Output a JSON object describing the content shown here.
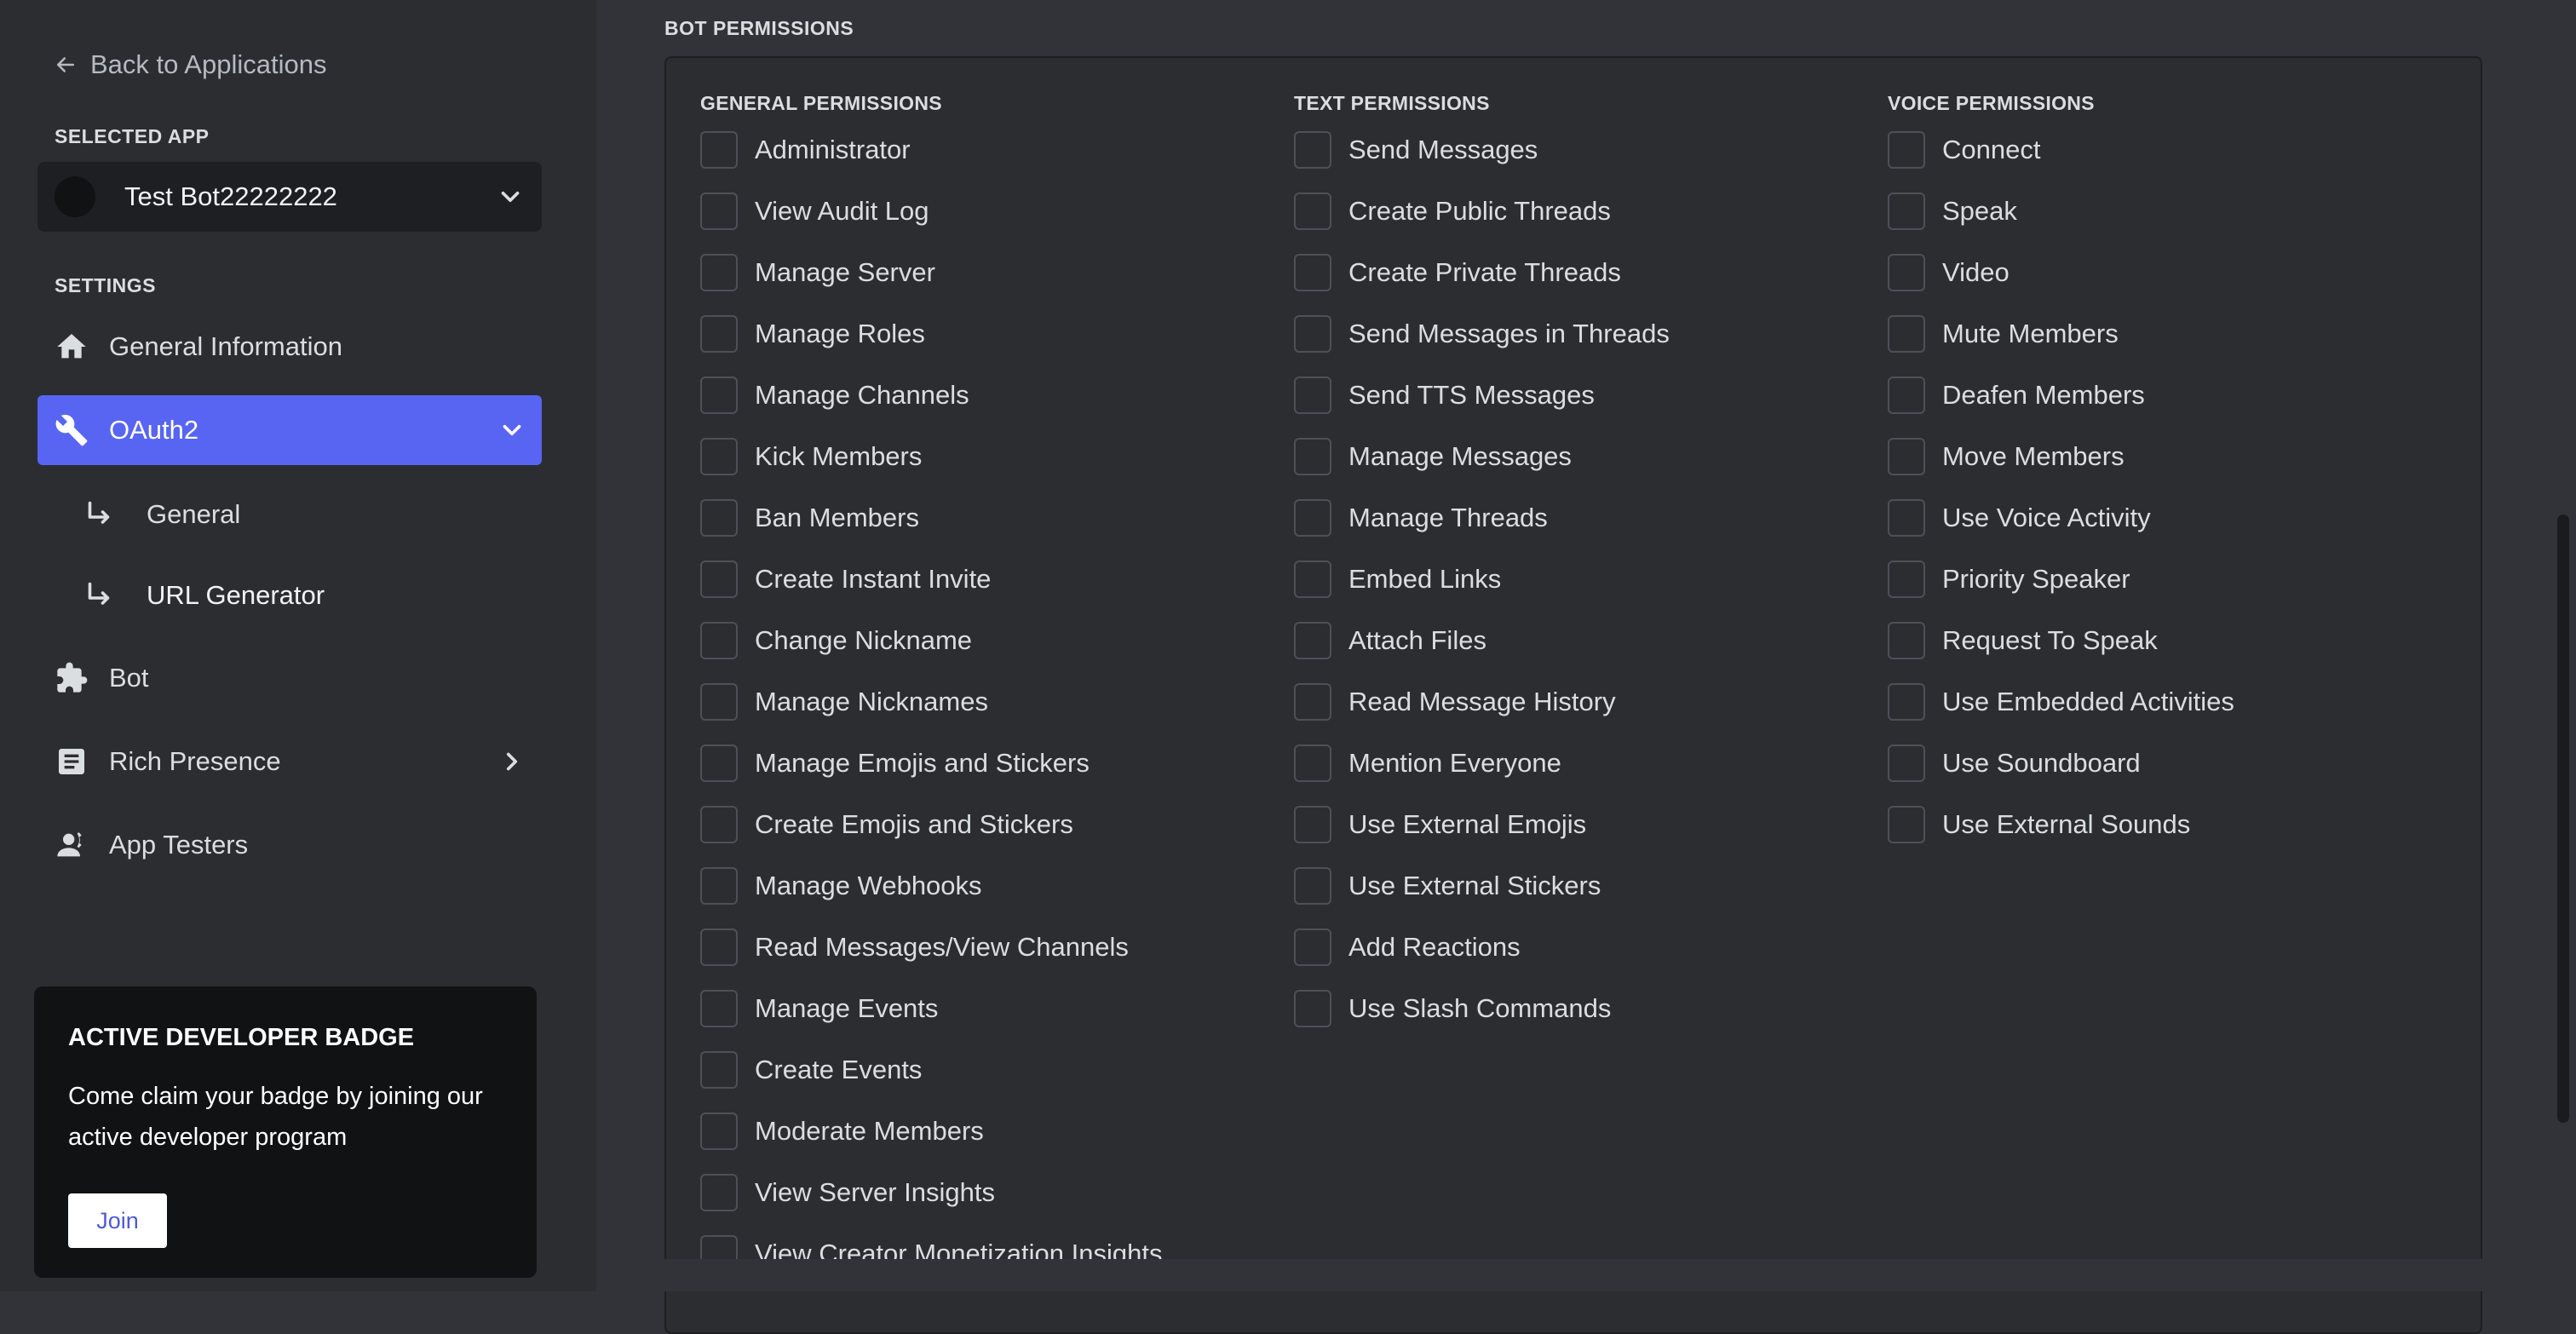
{
  "sidebar": {
    "back_label": "Back to Applications",
    "selected_app_label": "SELECTED APP",
    "selected_app_name": "Test Bot22222222",
    "settings_label": "SETTINGS",
    "nav": {
      "general_information": "General Information",
      "oauth2": "OAuth2",
      "oauth2_general": "General",
      "oauth2_url_generator": "URL Generator",
      "bot": "Bot",
      "rich_presence": "Rich Presence",
      "app_testers": "App Testers"
    },
    "badge": {
      "title": "ACTIVE DEVELOPER BADGE",
      "text": "Come claim your badge by joining our active developer program",
      "join_label": "Join"
    }
  },
  "main": {
    "heading": "BOT PERMISSIONS",
    "columns": [
      {
        "heading": "GENERAL PERMISSIONS",
        "items": [
          "Administrator",
          "View Audit Log",
          "Manage Server",
          "Manage Roles",
          "Manage Channels",
          "Kick Members",
          "Ban Members",
          "Create Instant Invite",
          "Change Nickname",
          "Manage Nicknames",
          "Manage Emojis and Stickers",
          "Create Emojis and Stickers",
          "Manage Webhooks",
          "Read Messages/View Channels",
          "Manage Events",
          "Create Events",
          "Moderate Members",
          "View Server Insights",
          "View Creator Monetization Insights"
        ]
      },
      {
        "heading": "TEXT PERMISSIONS",
        "items": [
          "Send Messages",
          "Create Public Threads",
          "Create Private Threads",
          "Send Messages in Threads",
          "Send TTS Messages",
          "Manage Messages",
          "Manage Threads",
          "Embed Links",
          "Attach Files",
          "Read Message History",
          "Mention Everyone",
          "Use External Emojis",
          "Use External Stickers",
          "Add Reactions",
          "Use Slash Commands"
        ]
      },
      {
        "heading": "VOICE PERMISSIONS",
        "items": [
          "Connect",
          "Speak",
          "Video",
          "Mute Members",
          "Deafen Members",
          "Move Members",
          "Use Voice Activity",
          "Priority Speaker",
          "Request To Speak",
          "Use Embedded Activities",
          "Use Soundboard",
          "Use External Sounds"
        ]
      }
    ]
  },
  "colors": {
    "accent": "#5865f2",
    "sidebar_bg": "#2b2d31",
    "main_bg": "#313338",
    "card_bg": "#111214"
  }
}
